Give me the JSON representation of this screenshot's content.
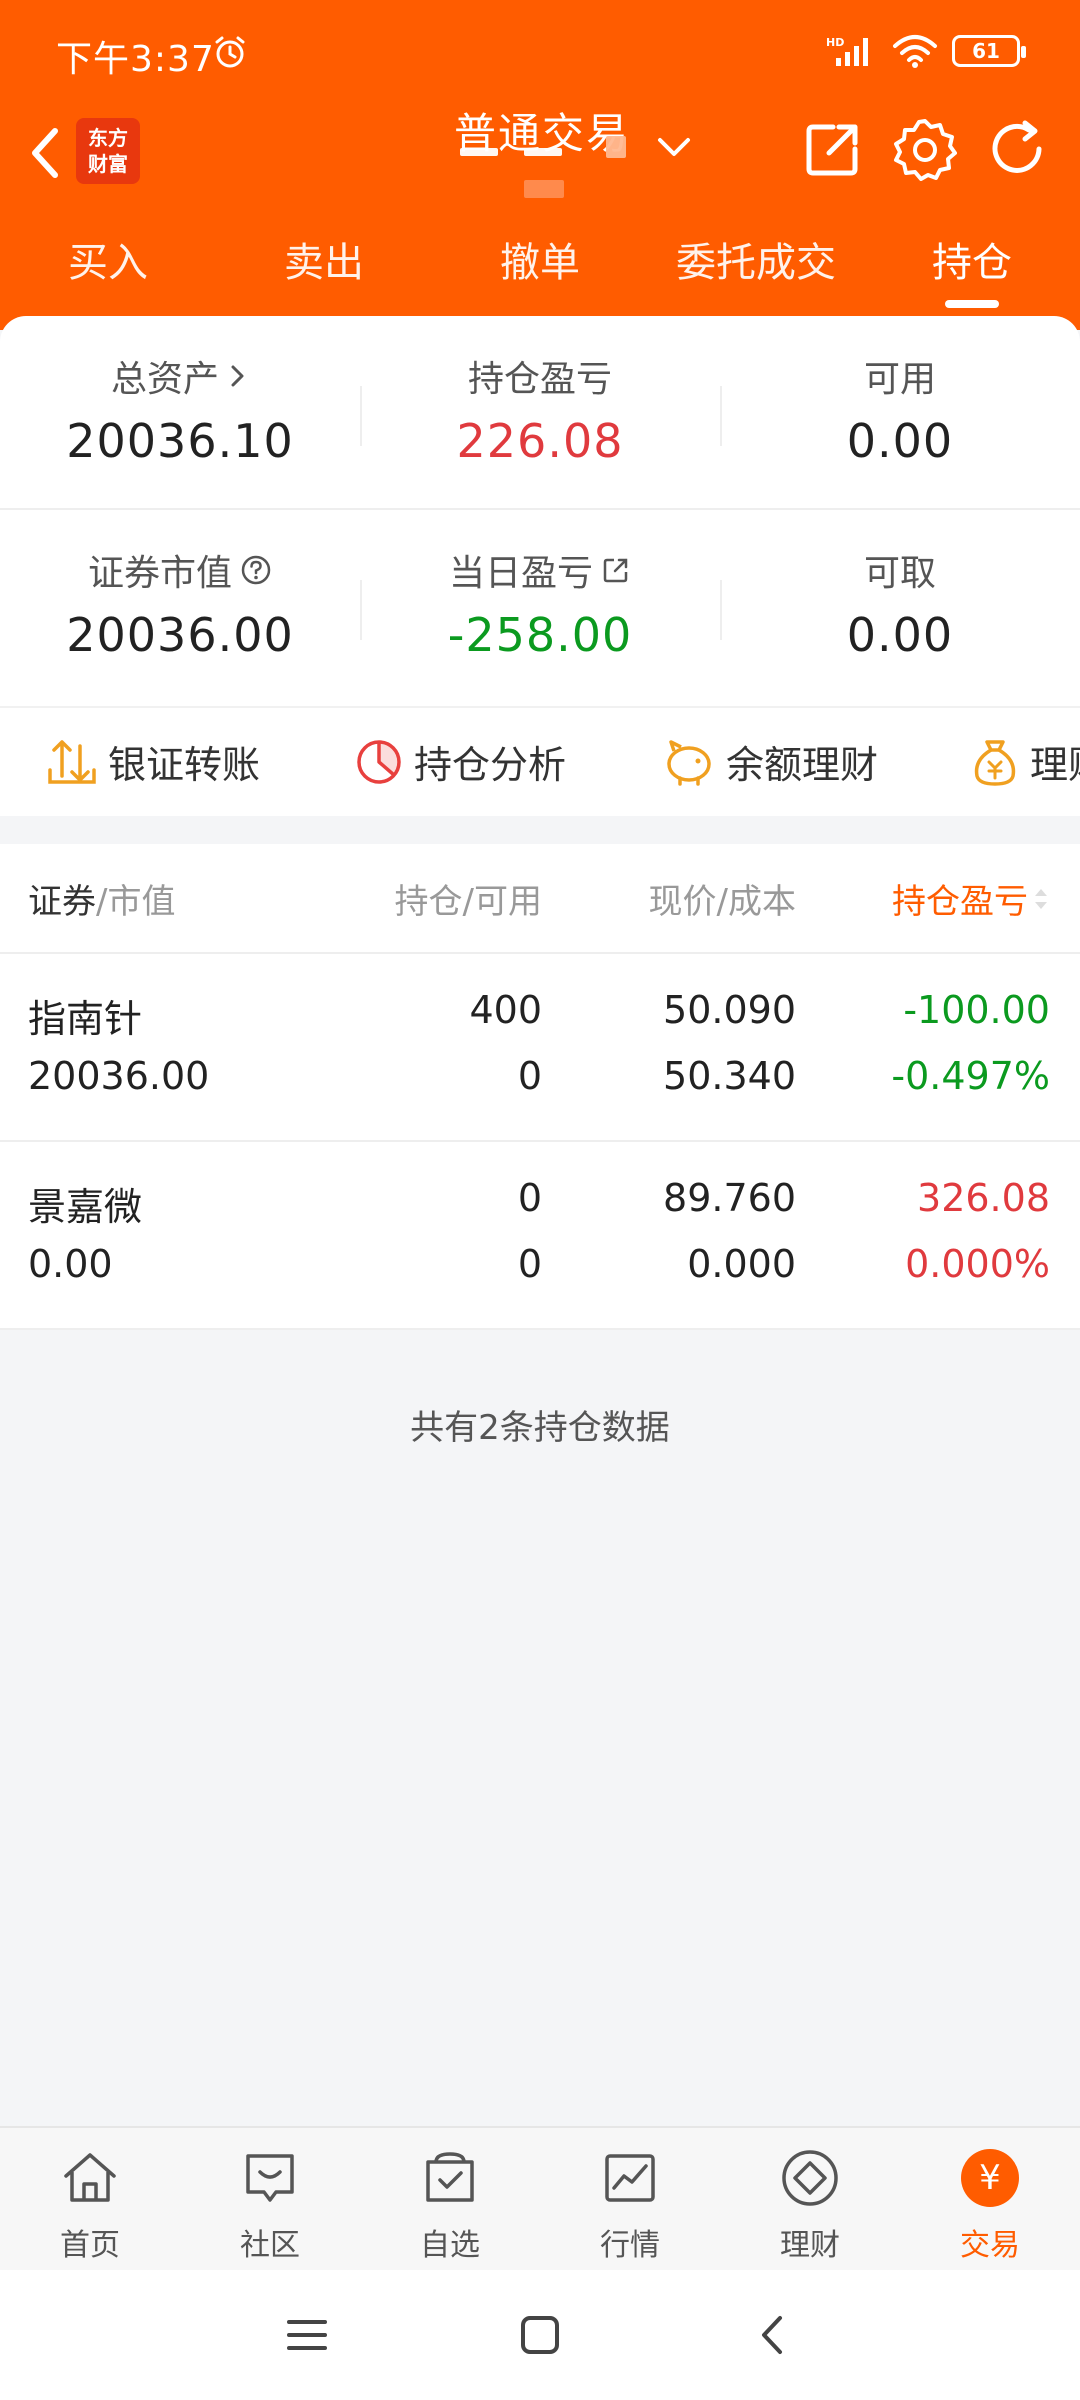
{
  "status_bar": {
    "time": "下午3:37",
    "battery": "61",
    "network": "HD"
  },
  "header": {
    "brand_line1": "东方",
    "brand_line2": "财富",
    "title": "普通交易",
    "tabs": [
      {
        "label": "买入"
      },
      {
        "label": "卖出"
      },
      {
        "label": "撤单"
      },
      {
        "label": "委托成交"
      },
      {
        "label": "持仓",
        "active": true
      }
    ]
  },
  "summary": {
    "total_assets": {
      "label": "总资产",
      "value": "20036.10"
    },
    "holding_pl": {
      "label": "持仓盈亏",
      "value": "226.08"
    },
    "available": {
      "label": "可用",
      "value": "0.00"
    },
    "market_value": {
      "label": "证券市值",
      "value": "20036.00"
    },
    "daily_pl": {
      "label": "当日盈亏",
      "value": "-258.00"
    },
    "withdrawable": {
      "label": "可取",
      "value": "0.00"
    }
  },
  "quick_links": [
    {
      "label": "银证转账",
      "icon": "transfer-icon"
    },
    {
      "label": "持仓分析",
      "icon": "pie-chart-icon"
    },
    {
      "label": "余额理财",
      "icon": "piggy-bank-icon"
    },
    {
      "label": "理财",
      "icon": "money-bag-icon"
    }
  ],
  "table": {
    "headers": {
      "security": "证券",
      "security_sub": "/市值",
      "position": "持仓/可用",
      "price": "现价/成本",
      "pl": "持仓盈亏"
    },
    "rows": [
      {
        "name": "指南针",
        "market_value": "20036.00",
        "position": "400",
        "available": "0",
        "price": "50.090",
        "cost": "50.340",
        "pl": "-100.00",
        "pl_pct": "-0.497%"
      },
      {
        "name": "景嘉微",
        "market_value": "0.00",
        "position": "0",
        "available": "0",
        "price": "89.760",
        "cost": "0.000",
        "pl": "326.08",
        "pl_pct": "0.000%"
      }
    ],
    "footer": "共有2条持仓数据"
  },
  "bottom_nav": [
    {
      "label": "首页",
      "icon": "home-icon"
    },
    {
      "label": "社区",
      "icon": "community-icon"
    },
    {
      "label": "自选",
      "icon": "watchlist-icon"
    },
    {
      "label": "行情",
      "icon": "market-icon"
    },
    {
      "label": "理财",
      "icon": "wealth-icon"
    },
    {
      "label": "交易",
      "icon": "trade-icon",
      "active": true,
      "glyph": "¥"
    }
  ],
  "colors": {
    "accent": "#ff5c00",
    "gain": "#e03a3e",
    "loss": "#0b9a1f"
  }
}
